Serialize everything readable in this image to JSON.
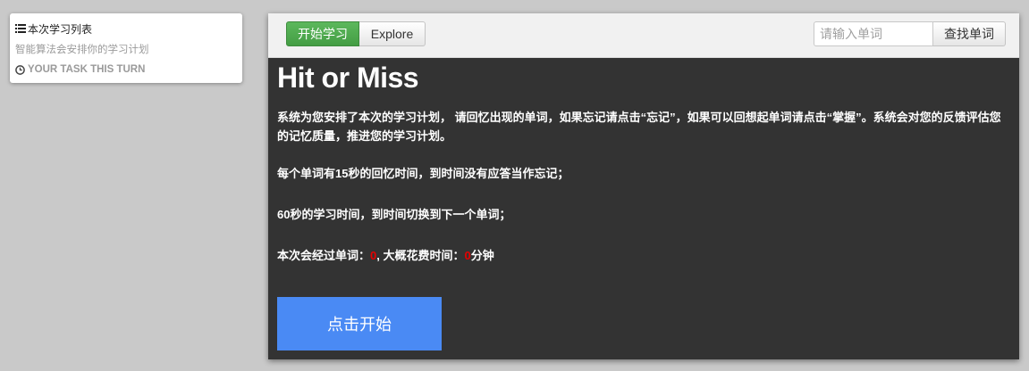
{
  "sidebar": {
    "title": "本次学习列表",
    "subtitle": "智能算法会安排你的学习计划",
    "task_label": "YOUR TASK THIS TURN"
  },
  "toolbar": {
    "study_button": "开始学习",
    "explore_button": "Explore",
    "search_placeholder": "请输入单词",
    "search_button": "查找单词"
  },
  "main": {
    "heading": "Hit or Miss",
    "intro": "系统为您安排了本次的学习计划， 请回忆出现的单词，如果忘记请点击“忘记”，如果可以回想起单词请点击“掌握”。系统会对您的反馈评估您的记忆质量，推进您的学习计划。",
    "rule_recall": "每个单词有15秒的回忆时间，到时间没有应答当作忘记；",
    "rule_study": "60秒的学习时间，到时间切换到下一个单词；",
    "summary": {
      "words_label": "本次会经过单词：",
      "words_count": "0",
      "time_label": ", 大概花费时间：",
      "time_value": "0",
      "time_unit": "分钟"
    },
    "start_button": "点击开始"
  },
  "colors": {
    "accent_green": "#5cb85c",
    "start_blue": "#4a8af4",
    "highlight_red": "#e60000",
    "panel_dark": "#333333"
  },
  "icons": {
    "sidebar_title": "list-icon",
    "task_label": "clock-icon"
  }
}
